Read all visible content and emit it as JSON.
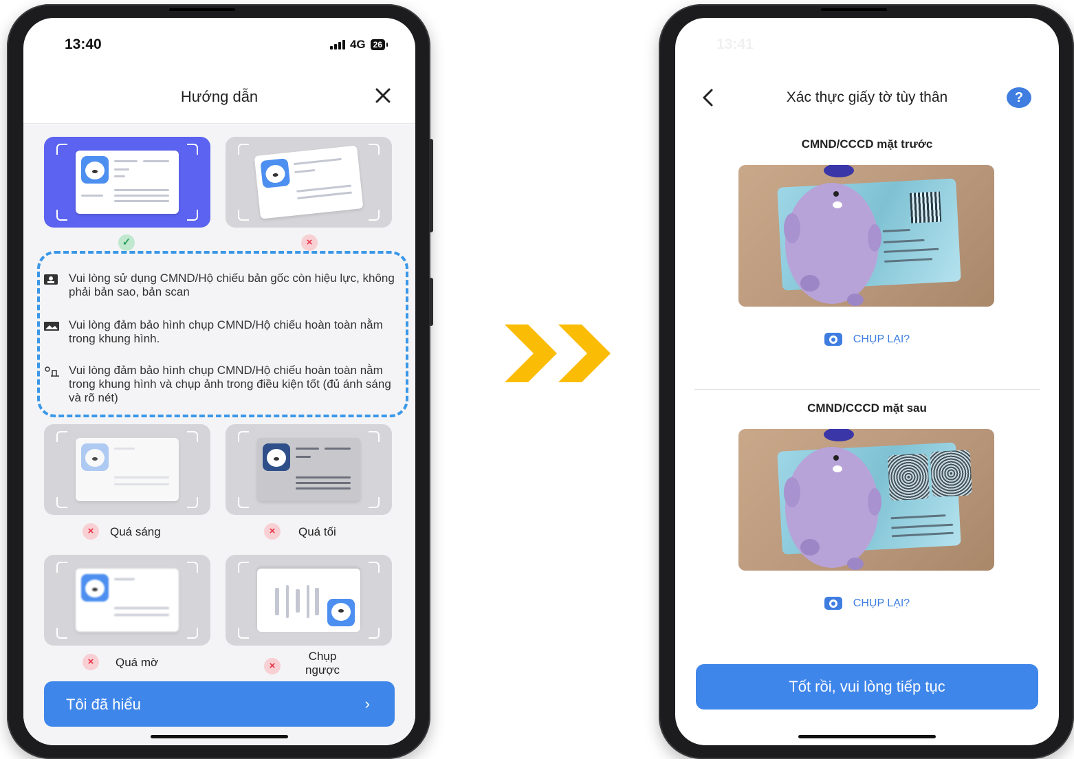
{
  "left": {
    "status": {
      "time": "13:40",
      "network": "4G",
      "battery": "26"
    },
    "header": {
      "title": "Hướng dẫn"
    },
    "tips": [
      {
        "icon": "id-badge-icon",
        "text": "Vui lòng sử dụng CMND/Hộ chiếu bản gốc còn hiệu lực, không phải bản sao, bản scan"
      },
      {
        "icon": "image-icon",
        "text": "Vui lòng đảm bảo hình chụp CMND/Hộ chiếu hoàn toàn nằm trong khung hình."
      },
      {
        "icon": "brightness-icon",
        "text": "Vui lòng đảm bảo hình chụp CMND/Hộ chiếu hoàn toàn nằm trong khung hình và chụp ảnh trong điều kiện tốt (đủ ánh sáng và rõ nét)"
      }
    ],
    "bad_examples": [
      "Quá sáng",
      "Quá tối",
      "Quá mờ",
      "Chụp ngược"
    ],
    "cta": {
      "label": "Tôi đã hiểu",
      "icon": "chevron-right-icon"
    }
  },
  "right": {
    "status": {
      "time": "13:41"
    },
    "header": {
      "title": "Xác thực giấy tờ tùy thân",
      "help": "?"
    },
    "front": {
      "title": "CMND/CCCD mặt trước",
      "retake": "CHỤP LẠI?"
    },
    "back": {
      "title": "CMND/CCCD mặt sau",
      "retake": "CHỤP LẠI?"
    },
    "cta": {
      "label": "Tốt rồi, vui lòng tiếp tục"
    }
  },
  "colors": {
    "primary": "#3f86ea",
    "accent_arrow": "#fbbc05",
    "good": "#2a9d57",
    "bad": "#e63346",
    "tip_border": "#3a97e8"
  }
}
